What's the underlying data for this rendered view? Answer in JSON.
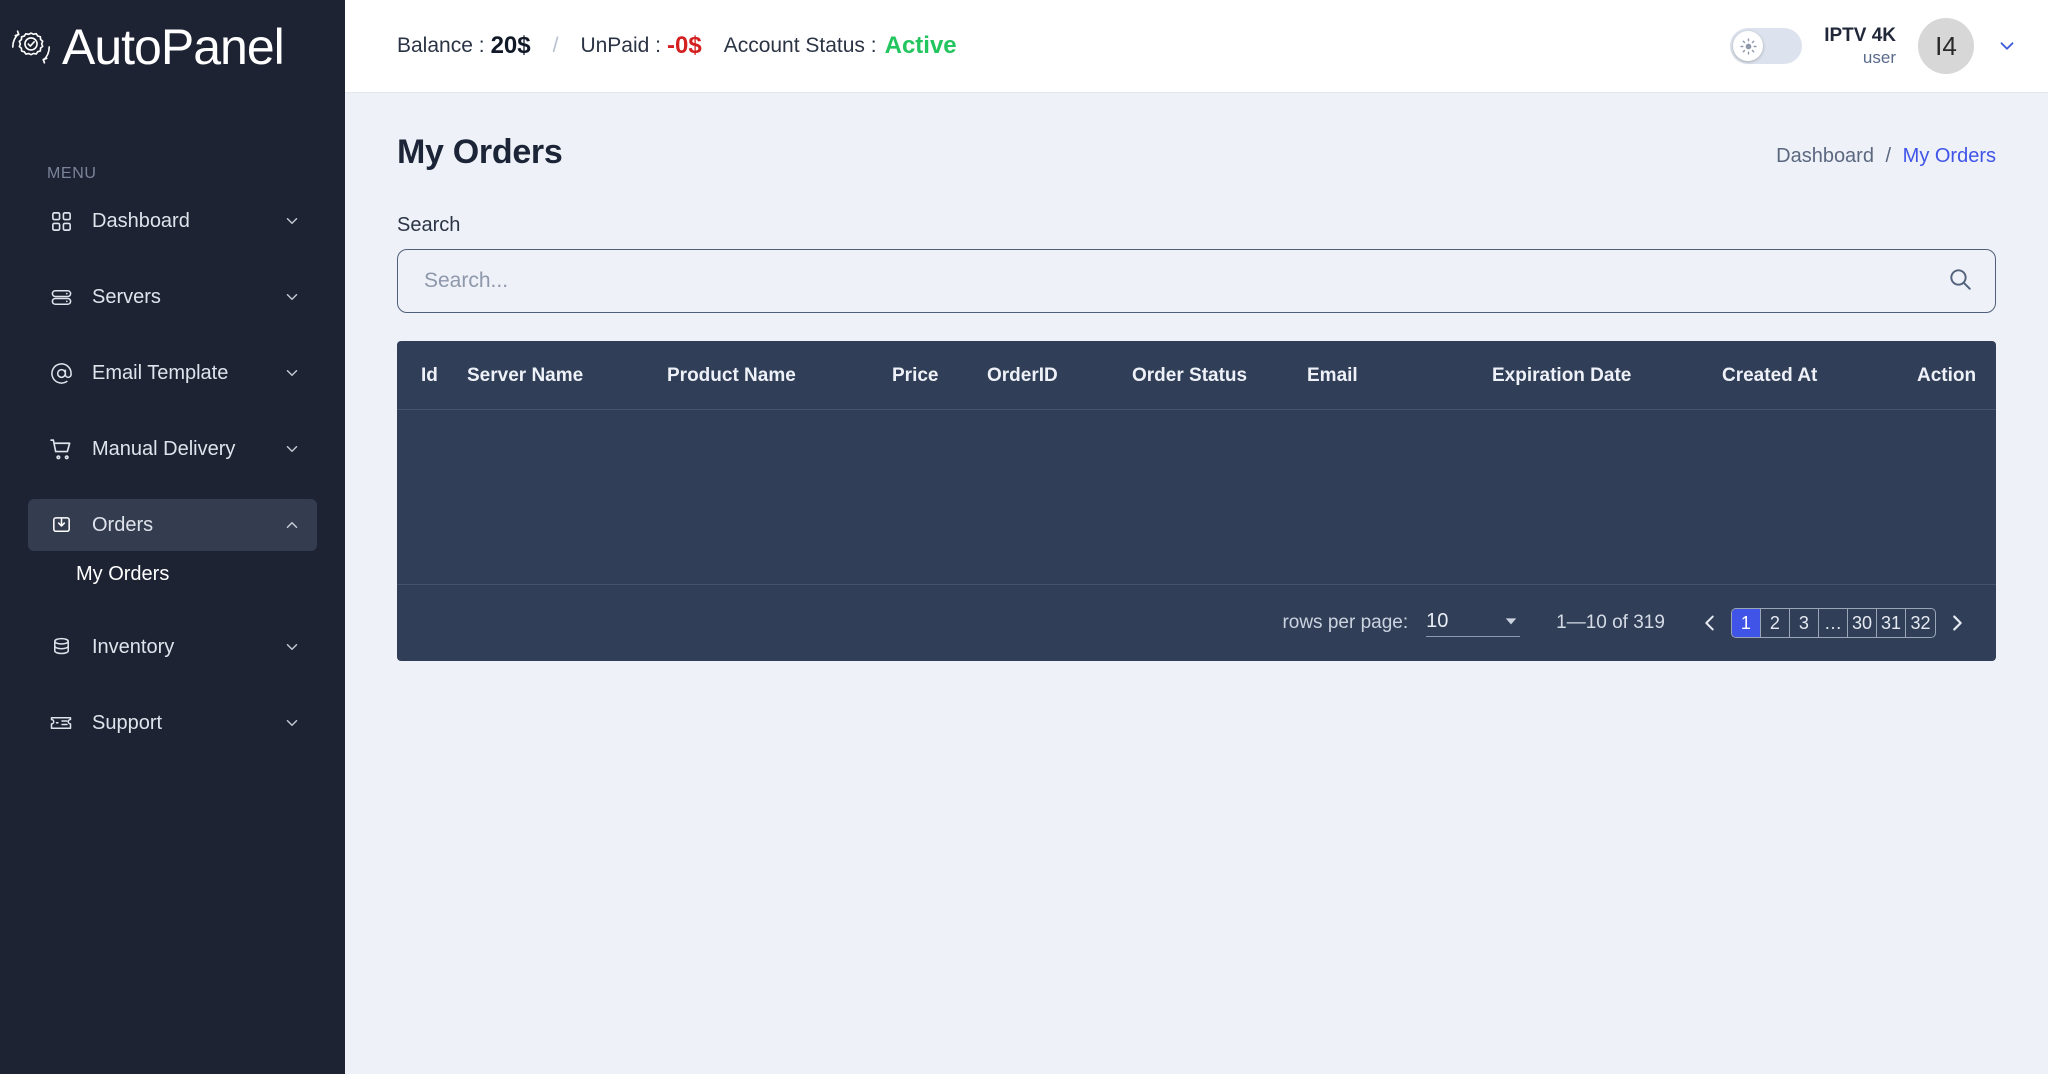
{
  "brand": {
    "name": "AutoPanel",
    "logo_icon": "gear-check-refresh-icon"
  },
  "sidebar": {
    "section_label": "MENU",
    "items": [
      {
        "label": "Dashboard",
        "icon": "grid-icon",
        "chevron": "chevron-down-icon"
      },
      {
        "label": "Servers",
        "icon": "server-icon",
        "chevron": "chevron-down-icon"
      },
      {
        "label": "Email Template",
        "icon": "at-sign-icon",
        "chevron": "chevron-down-icon"
      },
      {
        "label": "Manual Delivery",
        "icon": "cart-icon",
        "chevron": "chevron-down-icon"
      },
      {
        "label": "Orders",
        "icon": "inbox-down-icon",
        "chevron": "chevron-up-icon"
      },
      {
        "label": "Inventory",
        "icon": "database-icon",
        "chevron": "chevron-down-icon"
      },
      {
        "label": "Support",
        "icon": "ticket-icon",
        "chevron": "chevron-down-icon"
      }
    ],
    "sub_items": [
      {
        "label": "My Orders",
        "parent": "Orders"
      }
    ],
    "active_item": "Orders"
  },
  "topbar": {
    "balance_label": "Balance :",
    "balance_value": "20$",
    "separator": "/",
    "unpaid_label": "UnPaid :",
    "unpaid_value": "-0$",
    "status_label": "Account Status :",
    "status_value": "Active",
    "theme_toggle_icon": "sun-icon",
    "user_name": "IPTV 4K",
    "user_role": "user",
    "avatar_initials": "I4",
    "caret_icon": "chevron-down-icon"
  },
  "page": {
    "title": "My Orders",
    "breadcrumb": {
      "root": "Dashboard",
      "separator": "/",
      "current": "My Orders"
    }
  },
  "search": {
    "label": "Search",
    "placeholder": "Search...",
    "value": "",
    "icon": "search-icon"
  },
  "table": {
    "columns": [
      "Id",
      "Server Name",
      "Product Name",
      "Price",
      "OrderID",
      "Order Status",
      "Email",
      "Expiration Date",
      "Created At",
      "Action"
    ],
    "rows": []
  },
  "pagination": {
    "rows_per_page_label": "rows per page:",
    "rows_per_page_value": "10",
    "rows_per_page_arrow": "caret-down-icon",
    "range_text": "1—10 of 319",
    "prev_icon": "chevron-left-icon",
    "next_icon": "chevron-right-icon",
    "pages": [
      "1",
      "2",
      "3",
      "…",
      "30",
      "31",
      "32"
    ],
    "active_page": "1"
  },
  "colors": {
    "sidebar_bg": "#1d2333",
    "content_bg": "#eef1f7",
    "table_bg": "#303e57",
    "accent": "#4054e8",
    "status_active": "#22c55e",
    "unpaid": "#d31f1f"
  }
}
